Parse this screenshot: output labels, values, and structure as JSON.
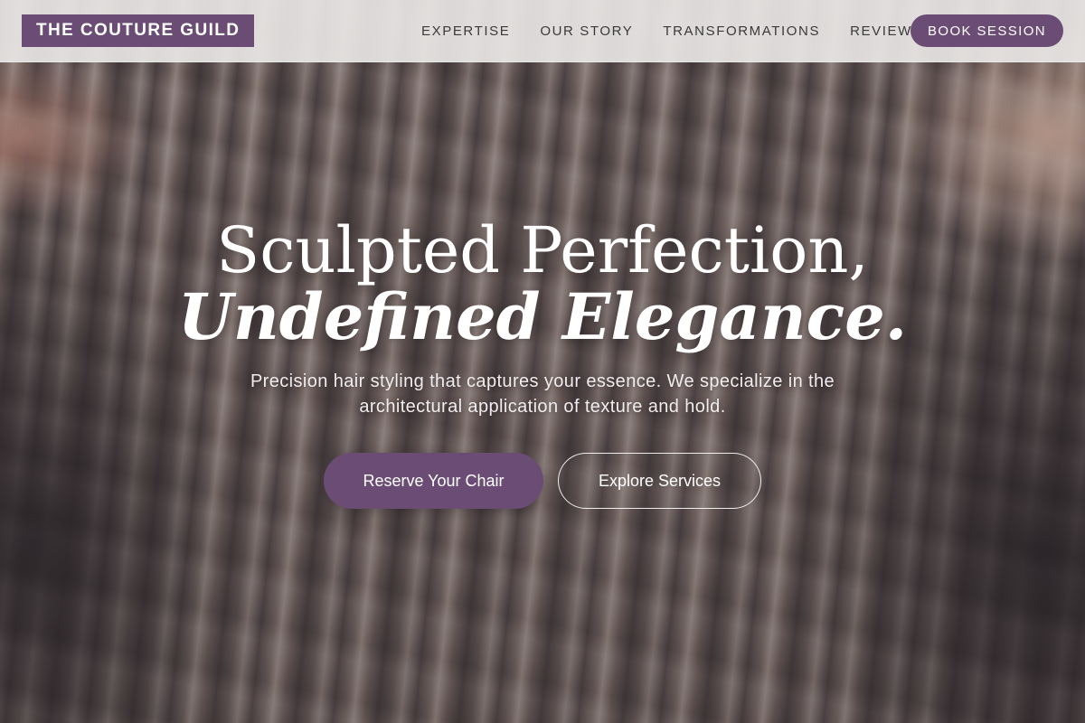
{
  "brand": {
    "name": "THE COUTURE GUILD",
    "accent_color": "#6b4c74"
  },
  "nav": {
    "items": [
      {
        "label": "EXPERTISE"
      },
      {
        "label": "OUR STORY"
      },
      {
        "label": "TRANSFORMATIONS"
      },
      {
        "label": "REVIEWS"
      }
    ],
    "cta_label": "BOOK SESSION"
  },
  "hero": {
    "background_image": "hair-waves-photo",
    "headline_line1": "Sculpted Perfection,",
    "headline_line2": "Undefined Elegance.",
    "subtext": "Precision hair styling that captures your essence. We specialize in the architectural application of texture and hold.",
    "primary_cta": "Reserve Your Chair",
    "secondary_cta": "Explore Services"
  }
}
